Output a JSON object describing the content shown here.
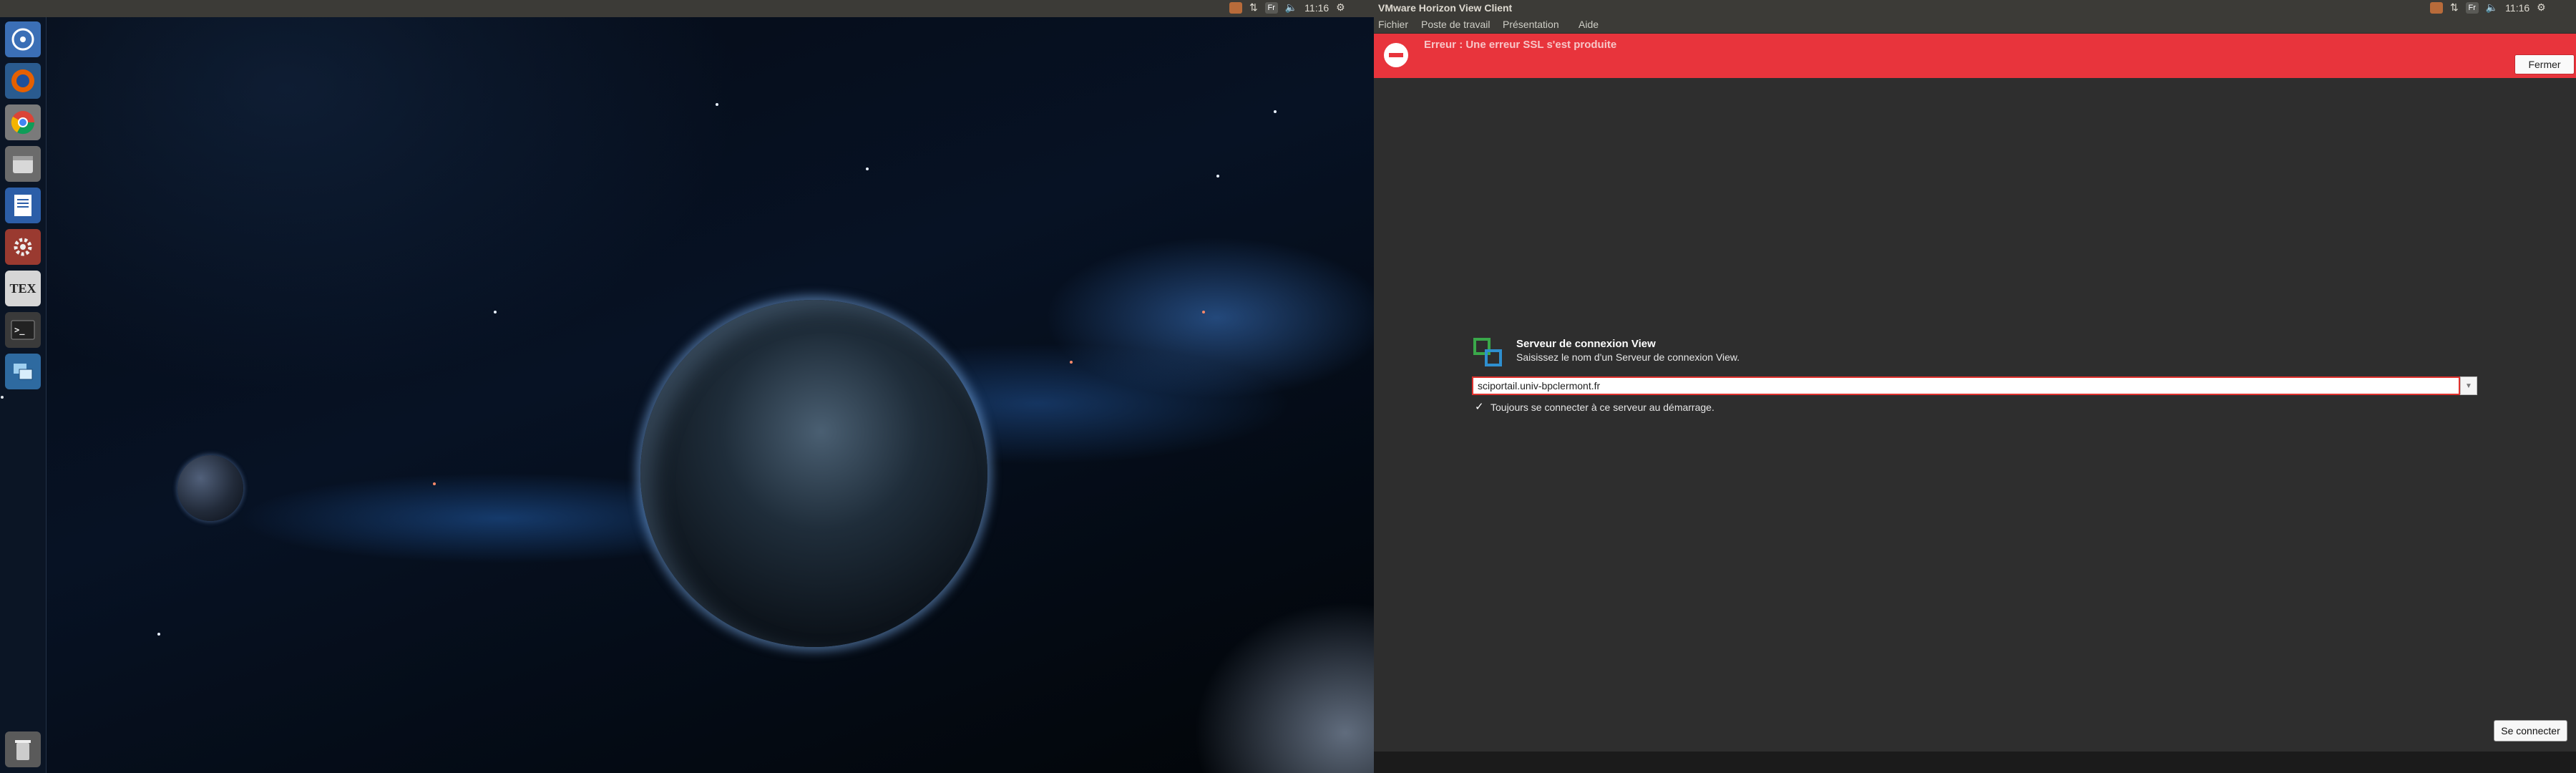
{
  "left_panel": {
    "time": "11:16",
    "keyboard_layout": "Fr"
  },
  "launcher": {
    "items": [
      {
        "name": "Recherche",
        "icon": "ubuntu-dash-icon"
      },
      {
        "name": "Firefox",
        "icon": "firefox-icon"
      },
      {
        "name": "Chrome",
        "icon": "chrome-icon"
      },
      {
        "name": "Fichiers",
        "icon": "file-manager-icon"
      },
      {
        "name": "Writer",
        "icon": "writer-icon"
      },
      {
        "name": "Paramètres",
        "icon": "settings-icon"
      },
      {
        "name": "TeX",
        "icon": "tex-icon",
        "label": "TEX"
      },
      {
        "name": "Terminal",
        "icon": "terminal-icon"
      },
      {
        "name": "VMware Horizon",
        "icon": "vmware-horizon-icon"
      },
      {
        "name": "Corbeille",
        "icon": "trash-icon"
      }
    ]
  },
  "window": {
    "title": "VMware Horizon View Client",
    "time": "11:16",
    "keyboard_layout": "Fr",
    "menu": [
      "Fichier",
      "Poste de travail",
      "Présentation",
      "Aide"
    ]
  },
  "error": {
    "message": "Erreur : Une erreur SSL s'est produite",
    "close_label": "Fermer"
  },
  "server": {
    "title": "Serveur de connexion View",
    "subtitle": "Saisissez le nom d'un Serveur de connexion View.",
    "value": "sciportail.univ-bpclermont.fr",
    "always_connect_label": "Toujours se connecter à ce serveur au démarrage.",
    "always_connect_checked": true,
    "connect_label": "Se connecter"
  },
  "colors": {
    "error_bg": "#e8343c",
    "window_bg": "#2e2e2e",
    "panel_bg": "#3c3b37"
  }
}
